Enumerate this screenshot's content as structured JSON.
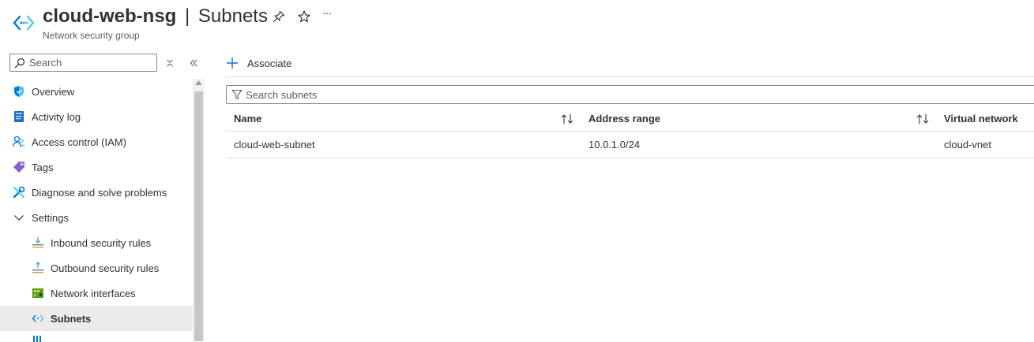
{
  "header": {
    "resource_name": "cloud-web-nsg",
    "separator": "|",
    "blade_title": "Subnets",
    "resource_type": "Network security group",
    "pin_icon": "pin-icon",
    "favorite_icon": "star-icon",
    "more_icon": "ellipsis-icon",
    "more_label": "···"
  },
  "sidebar": {
    "search": {
      "placeholder": "Search",
      "value": ""
    },
    "collapse_icon": "double-chevron-left-icon",
    "expand_icon": "expand-collapse-icon",
    "items": [
      {
        "label": "Overview",
        "icon": "overview-shield-icon",
        "level": 0
      },
      {
        "label": "Activity log",
        "icon": "activity-log-icon",
        "level": 0
      },
      {
        "label": "Access control (IAM)",
        "icon": "iam-users-icon",
        "level": 0
      },
      {
        "label": "Tags",
        "icon": "tag-icon",
        "level": 0
      },
      {
        "label": "Diagnose and solve problems",
        "icon": "wrench-icon",
        "level": 0
      },
      {
        "label": "Settings",
        "icon": "chevron-down-icon",
        "level": 0
      },
      {
        "label": "Inbound security rules",
        "icon": "inbound-rules-icon",
        "level": 1
      },
      {
        "label": "Outbound security rules",
        "icon": "outbound-rules-icon",
        "level": 1
      },
      {
        "label": "Network interfaces",
        "icon": "network-interface-icon",
        "level": 1
      },
      {
        "label": "Subnets",
        "icon": "subnet-icon",
        "level": 1,
        "active": true
      }
    ]
  },
  "toolbar": {
    "associate_label": "Associate"
  },
  "filter": {
    "placeholder": "Search subnets",
    "value": ""
  },
  "table": {
    "columns": [
      "Name",
      "Address range",
      "Virtual network"
    ],
    "rows": [
      {
        "name": "cloud-web-subnet",
        "address_range": "10.0.1.0/24",
        "virtual_network": "cloud-vnet"
      }
    ]
  },
  "colors": {
    "accent": "#0078d4",
    "active_bg": "#edebe9",
    "border": "#8a8886"
  }
}
